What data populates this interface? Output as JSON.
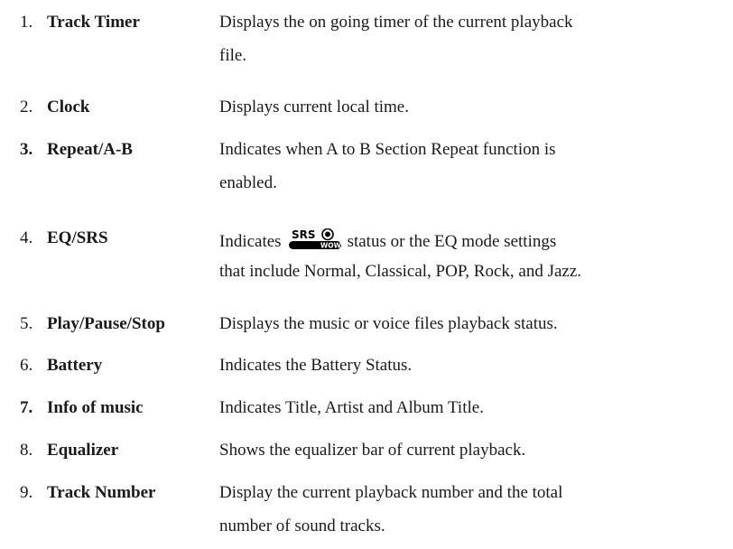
{
  "items": [
    {
      "number": "1.",
      "term": "Track Timer",
      "line1": "Displays the on going timer of the current playback",
      "line2": "file."
    },
    {
      "number": "2.",
      "term": "Clock",
      "line1": "Displays current local time."
    },
    {
      "number": "3.",
      "term": "Repeat/A-B",
      "line1": "Indicates when A to B Section Repeat function is",
      "line2": "enabled."
    },
    {
      "number": "4.",
      "term": "EQ/SRS",
      "line1_before": "Indicates",
      "line1_after": "status or the EQ mode settings",
      "line2": "that include Normal, Classical, POP, Rock, and Jazz.",
      "logo_text_top": "SRS",
      "logo_text_bottom": "WOW"
    },
    {
      "number": "5.",
      "term": "Play/Pause/Stop",
      "line1": "Displays the music or voice files playback status."
    },
    {
      "number": "6.",
      "term": "Battery",
      "line1": "Indicates the Battery Status."
    },
    {
      "number": "7.",
      "term": "Info of music",
      "line1": "Indicates Title, Artist and Album Title."
    },
    {
      "number": "8.",
      "term": "Equalizer",
      "line1": "Shows the equalizer bar of current playback."
    },
    {
      "number": "9.",
      "term": "Track Number",
      "line1": "Display the current playback number and the total",
      "line2": "number of sound tracks."
    }
  ]
}
